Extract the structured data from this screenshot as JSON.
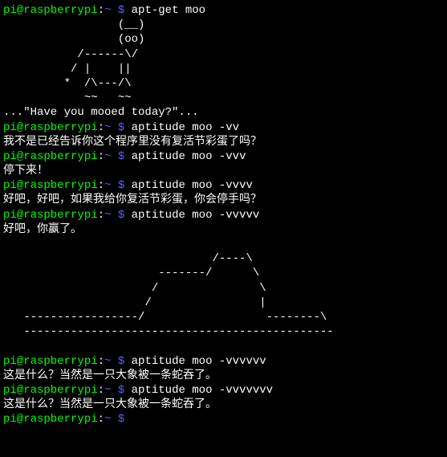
{
  "prompt": {
    "user_host": "pi@raspberrypi",
    "colon": ":",
    "path": "~ $",
    "dollar": " "
  },
  "commands": {
    "c1": "apt-get moo",
    "c2": "aptitude moo -vv",
    "c3": "aptitude moo -vvv",
    "c4": "aptitude moo -vvvv",
    "c5": "aptitude moo -vvvvv",
    "c6": "aptitude moo -vvvvvv",
    "c7": "aptitude moo -vvvvvvv",
    "c8": ""
  },
  "outputs": {
    "cow": "                 (__)\n                 (oo)\n           /------\\/\n          / |    ||\n         *  /\\---/\\\n            ~~   ~~\n...\"Have you mooed today?\"...",
    "o2": "我不是已经告诉你这个程序里没有复活节彩蛋了吗？",
    "o3": "停下来！",
    "o4": "好吧，好吧，如果我给你复活节彩蛋，你会停手吗？",
    "o5": "好吧，你赢了。\n\n                               /----\\\n                       -------/      \\\n                      /               \\\n                     /                |\n   -----------------/                  --------\\\n   ----------------------------------------------",
    "o6": "这是什么？当然是一只大象被一条蛇吞了。",
    "o7": "这是什么？当然是一只大象被一条蛇吞了。"
  }
}
